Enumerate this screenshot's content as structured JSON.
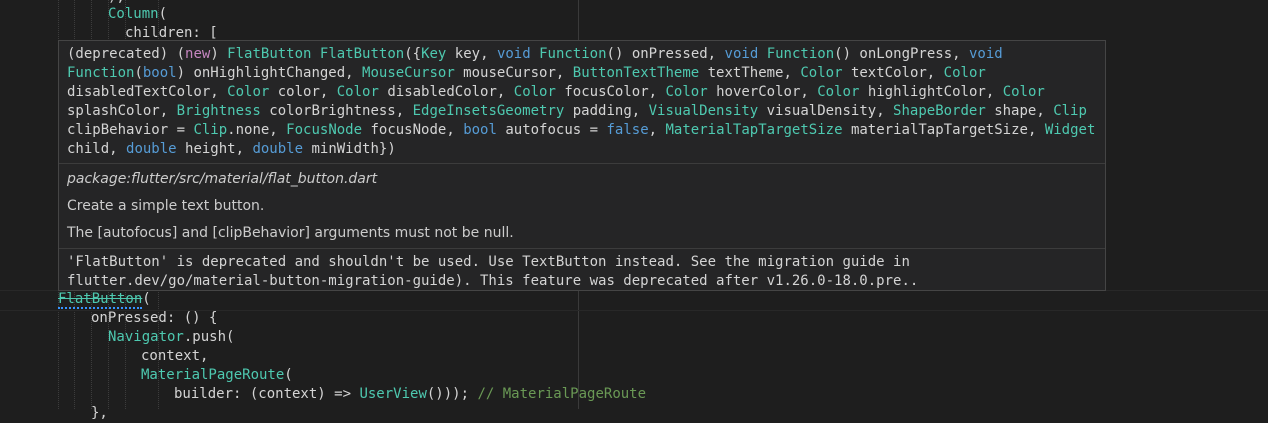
{
  "code": {
    "line0": "),",
    "line1_cls": "Column",
    "line1_rest": "(",
    "line2": "children: [",
    "line_cur_cls": "FlatButton",
    "line_cur_rest": "(",
    "line_on": "onPressed: () {",
    "line_nav_cls": "Navigator",
    "line_nav_rest": ".push(",
    "line_ctx": "context,",
    "line_mpr_cls": "MaterialPageRoute",
    "line_mpr_rest": "(",
    "line_builder_pre": "builder: (context) => ",
    "line_builder_cls": "UserView",
    "line_builder_post": "())); ",
    "line_builder_cmt": "// MaterialPageRoute",
    "line_last": "},"
  },
  "hover": {
    "signature": [
      {
        "t": "(deprecated) (",
        "c": "p"
      },
      {
        "t": "new",
        "c": "kw2"
      },
      {
        "t": ") ",
        "c": "p"
      },
      {
        "t": "FlatButton",
        "c": "ty"
      },
      {
        "t": " ",
        "c": "p"
      },
      {
        "t": "FlatButton",
        "c": "ty"
      },
      {
        "t": "({",
        "c": "p"
      },
      {
        "t": "Key",
        "c": "ty"
      },
      {
        "t": " key, ",
        "c": "p"
      },
      {
        "t": "void",
        "c": "kw"
      },
      {
        "t": " ",
        "c": "p"
      },
      {
        "t": "Function",
        "c": "ty"
      },
      {
        "t": "() onPressed, ",
        "c": "p"
      },
      {
        "t": "void",
        "c": "kw"
      },
      {
        "t": " ",
        "c": "p"
      },
      {
        "t": "Function",
        "c": "ty"
      },
      {
        "t": "() onLongPress, ",
        "c": "p"
      },
      {
        "t": "void",
        "c": "kw"
      },
      {
        "t": " ",
        "c": "p"
      },
      {
        "t": "Function",
        "c": "ty"
      },
      {
        "t": "(",
        "c": "p"
      },
      {
        "t": "bool",
        "c": "kw"
      },
      {
        "t": ") onHighlightChanged, ",
        "c": "p"
      },
      {
        "t": "MouseCursor",
        "c": "ty"
      },
      {
        "t": " mouseCursor, ",
        "c": "p"
      },
      {
        "t": "ButtonTextTheme",
        "c": "ty"
      },
      {
        "t": " textTheme, ",
        "c": "p"
      },
      {
        "t": "Color",
        "c": "ty"
      },
      {
        "t": " textColor, ",
        "c": "p"
      },
      {
        "t": "Color",
        "c": "ty"
      },
      {
        "t": " disabledTextColor, ",
        "c": "p"
      },
      {
        "t": "Color",
        "c": "ty"
      },
      {
        "t": " color, ",
        "c": "p"
      },
      {
        "t": "Color",
        "c": "ty"
      },
      {
        "t": " disabledColor, ",
        "c": "p"
      },
      {
        "t": "Color",
        "c": "ty"
      },
      {
        "t": " focusColor, ",
        "c": "p"
      },
      {
        "t": "Color",
        "c": "ty"
      },
      {
        "t": " hoverColor, ",
        "c": "p"
      },
      {
        "t": "Color",
        "c": "ty"
      },
      {
        "t": " highlightColor, ",
        "c": "p"
      },
      {
        "t": "Color",
        "c": "ty"
      },
      {
        "t": " splashColor, ",
        "c": "p"
      },
      {
        "t": "Brightness",
        "c": "ty"
      },
      {
        "t": " colorBrightness, ",
        "c": "p"
      },
      {
        "t": "EdgeInsetsGeometry",
        "c": "ty"
      },
      {
        "t": " padding, ",
        "c": "p"
      },
      {
        "t": "VisualDensity",
        "c": "ty"
      },
      {
        "t": " visualDensity, ",
        "c": "p"
      },
      {
        "t": "ShapeBorder",
        "c": "ty"
      },
      {
        "t": " shape, ",
        "c": "p"
      },
      {
        "t": "Clip",
        "c": "ty"
      },
      {
        "t": " clipBehavior = ",
        "c": "p"
      },
      {
        "t": "Clip",
        "c": "ty"
      },
      {
        "t": ".none, ",
        "c": "p"
      },
      {
        "t": "FocusNode",
        "c": "ty"
      },
      {
        "t": " focusNode, ",
        "c": "p"
      },
      {
        "t": "bool",
        "c": "kw"
      },
      {
        "t": " autofocus = ",
        "c": "p"
      },
      {
        "t": "false",
        "c": "kw"
      },
      {
        "t": ", ",
        "c": "p"
      },
      {
        "t": "MaterialTapTargetSize",
        "c": "ty"
      },
      {
        "t": " materialTapTargetSize, ",
        "c": "p"
      },
      {
        "t": "Widget",
        "c": "ty"
      },
      {
        "t": " child, ",
        "c": "p"
      },
      {
        "t": "double",
        "c": "kw"
      },
      {
        "t": " height, ",
        "c": "p"
      },
      {
        "t": "double",
        "c": "kw"
      },
      {
        "t": " minWidth})",
        "c": "p"
      }
    ],
    "package_path": "package:flutter/src/material/flat_button.dart",
    "doc_line1": "Create a simple text button.",
    "doc_line2": "The [autofocus] and [clipBehavior] arguments must not be null.",
    "deprecation_message": "'FlatButton' is deprecated and shouldn't be used. Use TextButton instead. See the migration guide in flutter.dev/go/material-button-migration-guide). This feature was deprecated after v1.26.0-18.0.pre.."
  },
  "colors": {
    "background": "#1e1e1e",
    "hover_bg": "#252526",
    "type": "#4ec9b0",
    "keyword": "#569cd6",
    "keyword_new": "#c586c0",
    "comment": "#6a9955"
  }
}
